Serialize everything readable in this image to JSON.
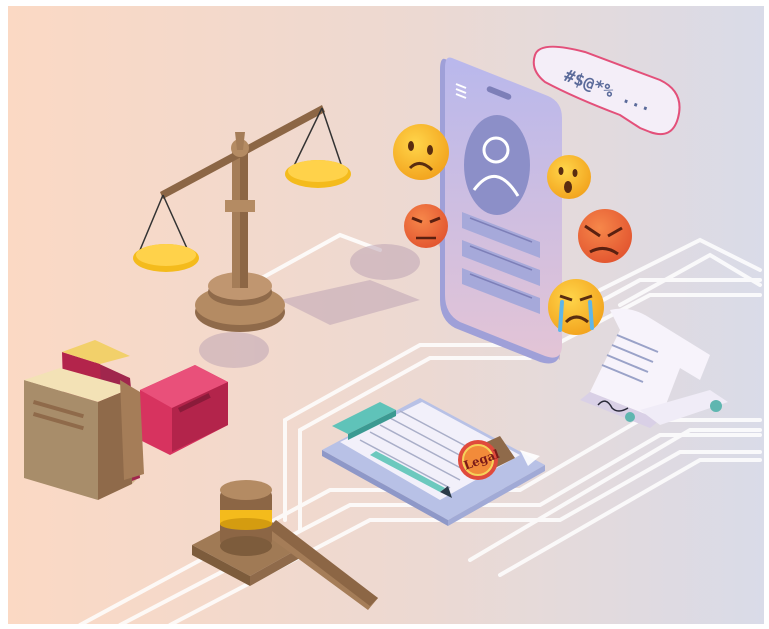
{
  "illustration": {
    "speech_bubble_text": "#$@*% ...",
    "stamp_text": "Legal",
    "icons": [
      "scales-of-justice-icon",
      "smartphone-icon",
      "emoji-sad-icon",
      "emoji-shocked-icon",
      "emoji-angry-icon",
      "emoji-crying-icon",
      "books-icon",
      "gavel-icon",
      "clipboard-document-icon",
      "stamp-icon",
      "signed-contract-icon",
      "speech-bubble-icon"
    ],
    "colors": {
      "background_left": "#fbd9c4",
      "background_right": "#d9dbe8",
      "gold": "#f4bb1c",
      "wood": "#a07a55",
      "phone": "#c9c2e6",
      "crimson": "#d7335f",
      "circuit_lines": "#ffffff"
    }
  }
}
